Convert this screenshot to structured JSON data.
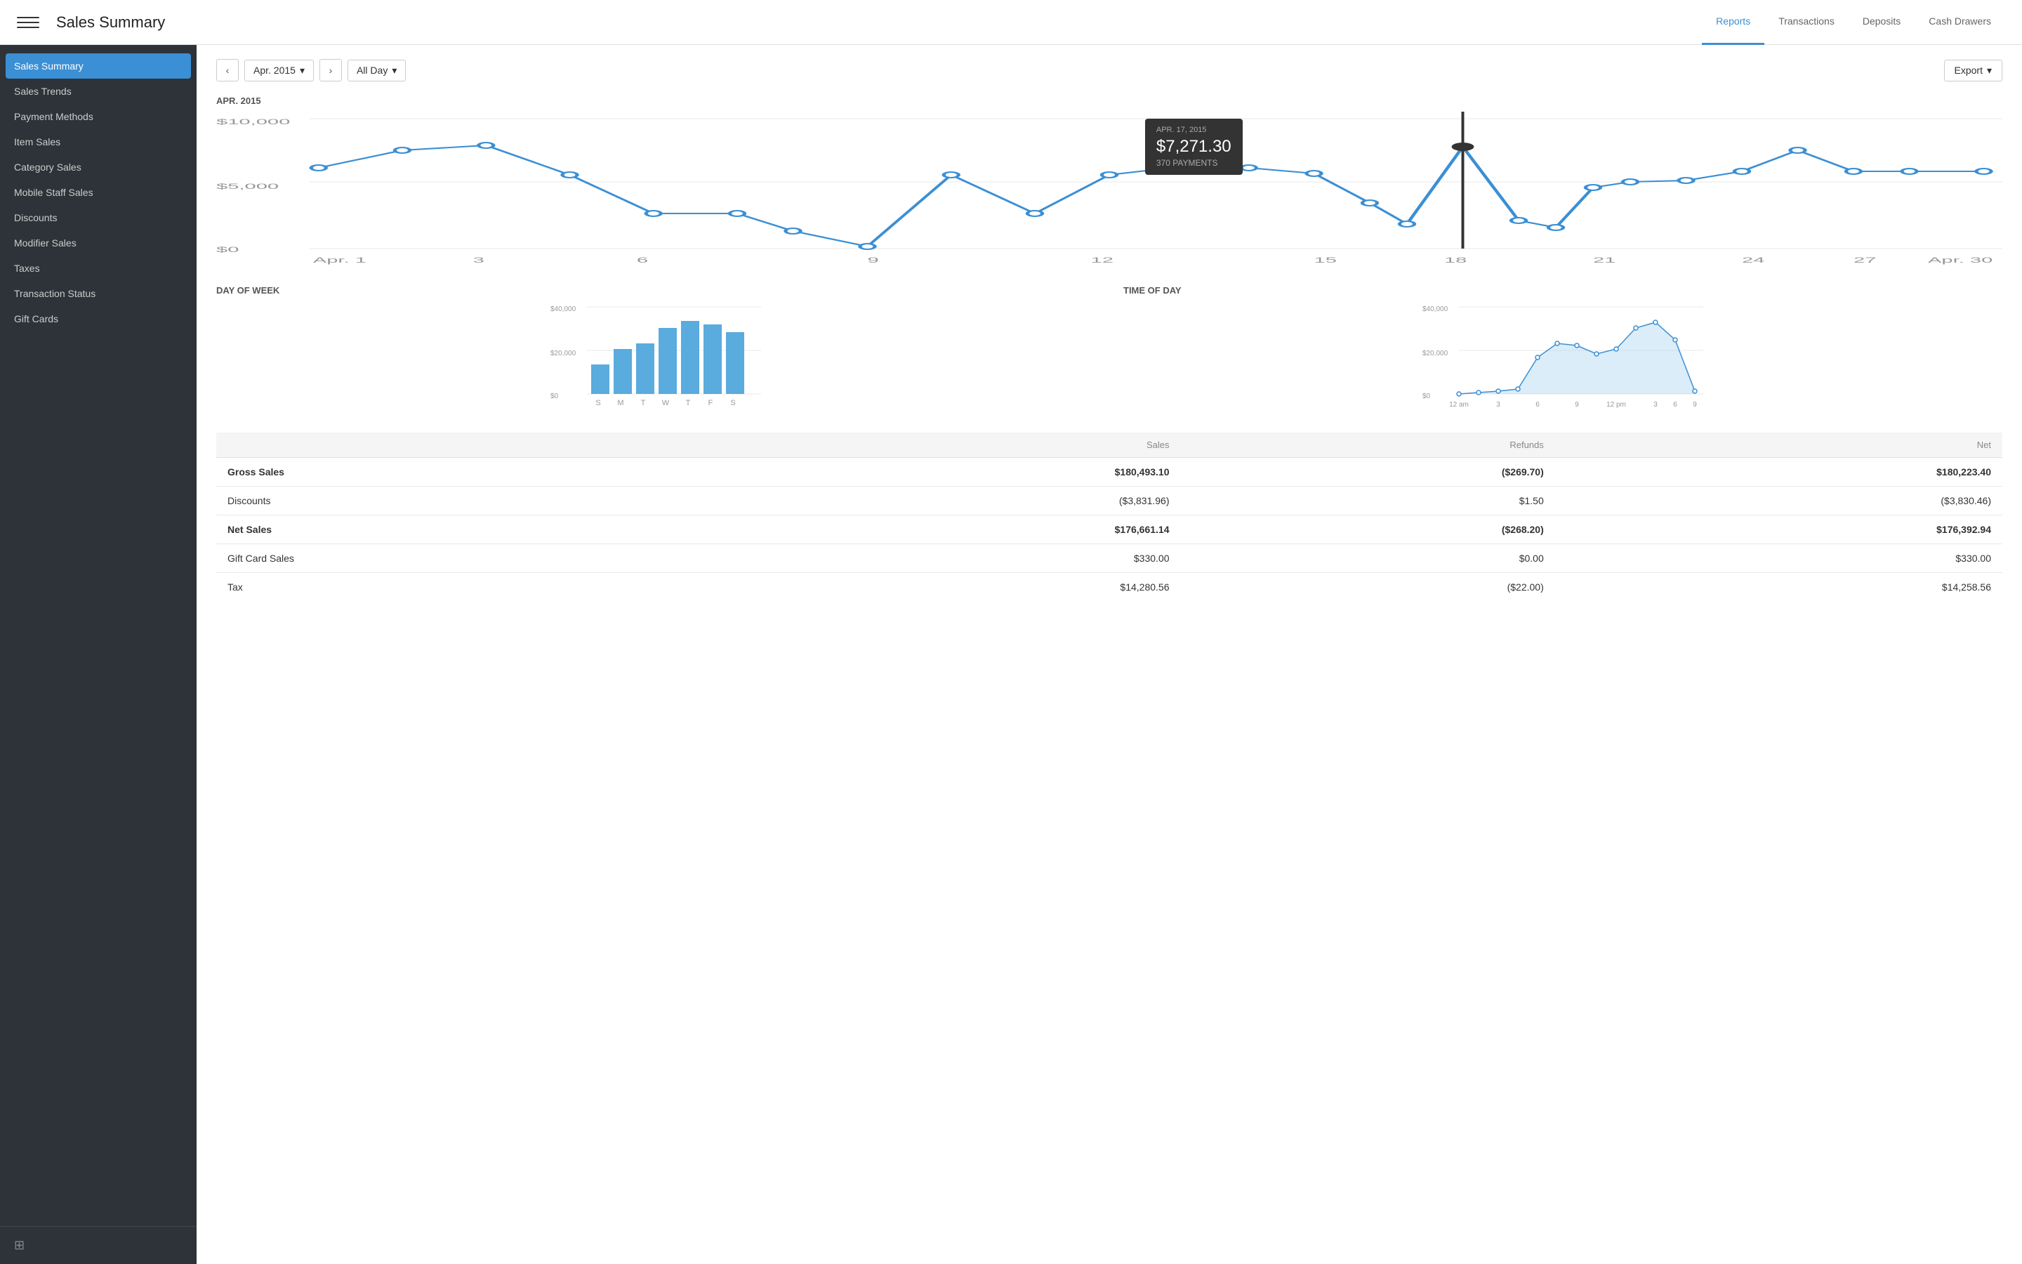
{
  "header": {
    "title": "Sales Summary",
    "menu_icon": "☰",
    "nav": [
      {
        "label": "Reports",
        "active": true
      },
      {
        "label": "Transactions",
        "active": false
      },
      {
        "label": "Deposits",
        "active": false
      },
      {
        "label": "Cash Drawers",
        "active": false
      }
    ]
  },
  "sidebar": {
    "items": [
      {
        "label": "Sales Summary",
        "active": true
      },
      {
        "label": "Sales Trends",
        "active": false
      },
      {
        "label": "Payment Methods",
        "active": false
      },
      {
        "label": "Item Sales",
        "active": false
      },
      {
        "label": "Category Sales",
        "active": false
      },
      {
        "label": "Mobile Staff Sales",
        "active": false
      },
      {
        "label": "Discounts",
        "active": false
      },
      {
        "label": "Modifier Sales",
        "active": false
      },
      {
        "label": "Taxes",
        "active": false
      },
      {
        "label": "Transaction Status",
        "active": false
      },
      {
        "label": "Gift Cards",
        "active": false
      }
    ]
  },
  "toolbar": {
    "prev_label": "‹",
    "next_label": "›",
    "date_label": "Apr. 2015",
    "time_label": "All Day",
    "export_label": "Export"
  },
  "main_chart": {
    "period_label": "APR. 2015",
    "y_axis": [
      "$10,000",
      "$5,000",
      "$0"
    ],
    "x_axis": [
      "Apr. 1",
      "3",
      "6",
      "9",
      "12",
      "15",
      "18",
      "21",
      "24",
      "27",
      "Apr. 30"
    ],
    "tooltip": {
      "date": "APR. 17, 2015",
      "amount": "$7,271.30",
      "payments": "370 PAYMENTS"
    }
  },
  "dow_chart": {
    "title": "DAY OF WEEK",
    "y_axis": [
      "$40,000",
      "$20,000",
      "$0"
    ],
    "x_labels": [
      "S",
      "M",
      "T",
      "W",
      "T",
      "F",
      "S"
    ],
    "values": [
      30,
      55,
      60,
      78,
      85,
      80,
      70
    ]
  },
  "tod_chart": {
    "title": "TIME OF DAY",
    "y_axis": [
      "$40,000",
      "$20,000",
      "$0"
    ],
    "x_labels": [
      "12 am",
      "3",
      "6",
      "9",
      "12 pm",
      "3",
      "6",
      "9"
    ]
  },
  "summary_table": {
    "columns": [
      "",
      "Sales",
      "Refunds",
      "Net"
    ],
    "rows": [
      {
        "label": "Gross Sales",
        "sales": "$180,493.10",
        "refunds": "($269.70)",
        "net": "$180,223.40",
        "bold": true
      },
      {
        "label": "Discounts",
        "sales": "($3,831.96)",
        "refunds": "$1.50",
        "net": "($3,830.46)",
        "bold": false
      },
      {
        "label": "Net Sales",
        "sales": "$176,661.14",
        "refunds": "($268.20)",
        "net": "$176,392.94",
        "bold": true
      },
      {
        "label": "Gift Card Sales",
        "sales": "$330.00",
        "refunds": "$0.00",
        "net": "$330.00",
        "bold": false
      },
      {
        "label": "Tax",
        "sales": "$14,280.56",
        "refunds": "($22.00)",
        "net": "$14,258.56",
        "bold": false
      }
    ]
  },
  "colors": {
    "sidebar_bg": "#2d3338",
    "active_blue": "#3b8fd4",
    "chart_line": "#3b8fd4",
    "chart_dot": "#3b8fd4",
    "bar_fill": "#5aabde",
    "area_fill": "rgba(173, 216, 240, 0.5)",
    "tooltip_bg": "#333"
  }
}
